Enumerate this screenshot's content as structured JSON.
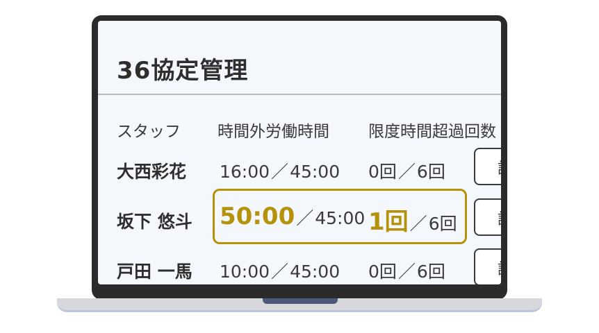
{
  "page": {
    "title": "36協定管理"
  },
  "table": {
    "headers": {
      "staff": "スタッフ",
      "overtime": "時間外労働時間",
      "exceed": "限度時間超過回数"
    },
    "rows": [
      {
        "name": "大西彩花",
        "overtime_used": "16:00",
        "overtime_limit": "45:00",
        "exceed_count": "0回",
        "exceed_limit": "6回",
        "button": "詳"
      },
      {
        "name": "坂下 悠斗",
        "overtime_used": "50:00",
        "overtime_limit": "45:00",
        "exceed_count": "1回",
        "exceed_limit": "6回",
        "button": "詳",
        "highlighted": true
      },
      {
        "name": "戸田 一馬",
        "overtime_used": "10:00",
        "overtime_limit": "45:00",
        "exceed_count": "0回",
        "exceed_limit": "6回",
        "button": "詳"
      }
    ],
    "separator": "／"
  },
  "colors": {
    "highlight": "#b5920a",
    "text": "#3a3a3a",
    "screen_bg": "#f4f7fb",
    "frame": "#2b2b2b"
  }
}
